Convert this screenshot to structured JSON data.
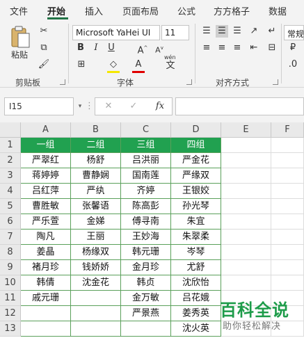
{
  "ribbon": {
    "tabs": [
      "文件",
      "开始",
      "插入",
      "页面布局",
      "公式",
      "方方格子",
      "数据"
    ],
    "groups": {
      "clipboard": "剪贴板",
      "font": "字体",
      "alignment": "对齐方式"
    },
    "paste_label": "粘贴",
    "font_name": "Microsoft YaHei UI",
    "font_size": "11",
    "number_format": "常规",
    "wen_label": "wén",
    "wen_char": "文"
  },
  "formula_bar": {
    "name_box": "I15",
    "fx_label": "fx",
    "formula": ""
  },
  "sheet": {
    "columns": [
      "A",
      "B",
      "C",
      "D",
      "E",
      "F"
    ],
    "rows": [
      "1",
      "2",
      "3",
      "4",
      "5",
      "6",
      "7",
      "8",
      "9",
      "10",
      "11",
      "12",
      "13"
    ],
    "headers": [
      "一组",
      "二组",
      "三组",
      "四组"
    ],
    "data": [
      [
        "严翠红",
        "杨舒",
        "吕洪丽",
        "严金花"
      ],
      [
        "蒋婷婷",
        "曹静娴",
        "国南莲",
        "严缘双"
      ],
      [
        "吕红萍",
        "严纨",
        "齐婷",
        "王银姣"
      ],
      [
        "曹胜敏",
        "张馨语",
        "陈高彭",
        "孙光琴"
      ],
      [
        "严乐萱",
        "金娣",
        "傅寻南",
        "朱宜"
      ],
      [
        "陶凡",
        "王丽",
        "王妙海",
        "朱翠柔"
      ],
      [
        "姜晶",
        "杨缘双",
        "韩元珊",
        "岑琴"
      ],
      [
        "褚月珍",
        "钱娇娇",
        "金月珍",
        "尤舒"
      ],
      [
        "韩倩",
        "沈金花",
        "韩贞",
        "沈欣怡"
      ],
      [
        "戚元珊",
        "",
        "金万敏",
        "吕花娥"
      ],
      [
        "",
        "",
        "严景燕",
        "姜秀英"
      ],
      [
        "",
        "",
        "",
        "沈火英"
      ]
    ]
  },
  "watermark": {
    "title": "百科全说",
    "subtitle": "助你轻松解决"
  },
  "colors": {
    "header_green": "#21a150",
    "accent": "#217346",
    "watermark_green": "#1e9c4a"
  }
}
